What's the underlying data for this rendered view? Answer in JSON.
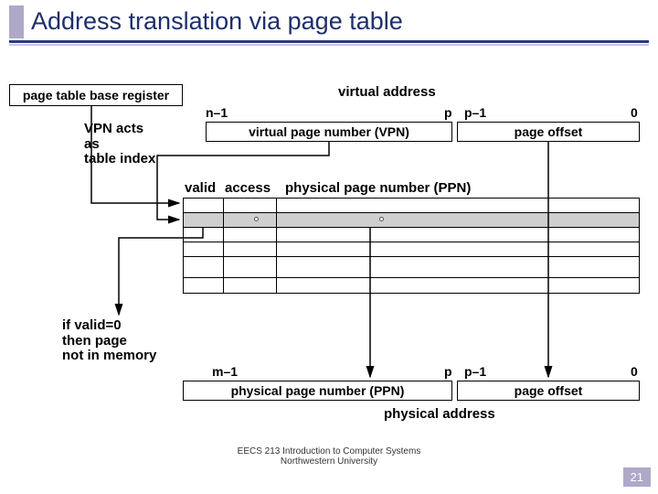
{
  "title": "Address translation via page table",
  "labels": {
    "ptbr": "page table base register",
    "va_title": "virtual address",
    "vpn_acts": "VPN acts\nas\ntable index",
    "hdr_valid": "valid",
    "hdr_access": "access",
    "hdr_ppn": "physical page number (PPN)",
    "if_valid": "if valid=0\nthen page\nnot in memory",
    "pa_title": "physical address"
  },
  "va": {
    "n1": "n–1",
    "p": "p",
    "p1": "p–1",
    "zero": "0",
    "vpn": "virtual page number (VPN)",
    "off": "page offset"
  },
  "pa": {
    "m1": "m–1",
    "p": "p",
    "p1": "p–1",
    "zero": "0",
    "ppn": "physical page number (PPN)",
    "off": "page offset"
  },
  "footer": {
    "line1": "EECS 213 Introduction to Computer Systems",
    "line2": "Northwestern University"
  },
  "page_number": "21"
}
